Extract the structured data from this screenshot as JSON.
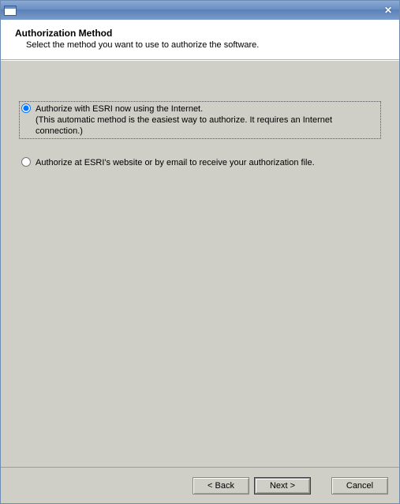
{
  "window": {
    "title": ""
  },
  "header": {
    "title": "Authorization Method",
    "subtitle": "Select the method you want to use to authorize the software."
  },
  "options": {
    "opt1_label": "Authorize with ESRI now using the Internet.",
    "opt1_sub": "(This automatic method is the easiest way to authorize. It requires an Internet connection.)",
    "opt2_label": "Authorize at ESRI's website or by email to receive your authorization file.",
    "selected_index": 0
  },
  "buttons": {
    "back": "< Back",
    "next": "Next >",
    "cancel": "Cancel"
  }
}
